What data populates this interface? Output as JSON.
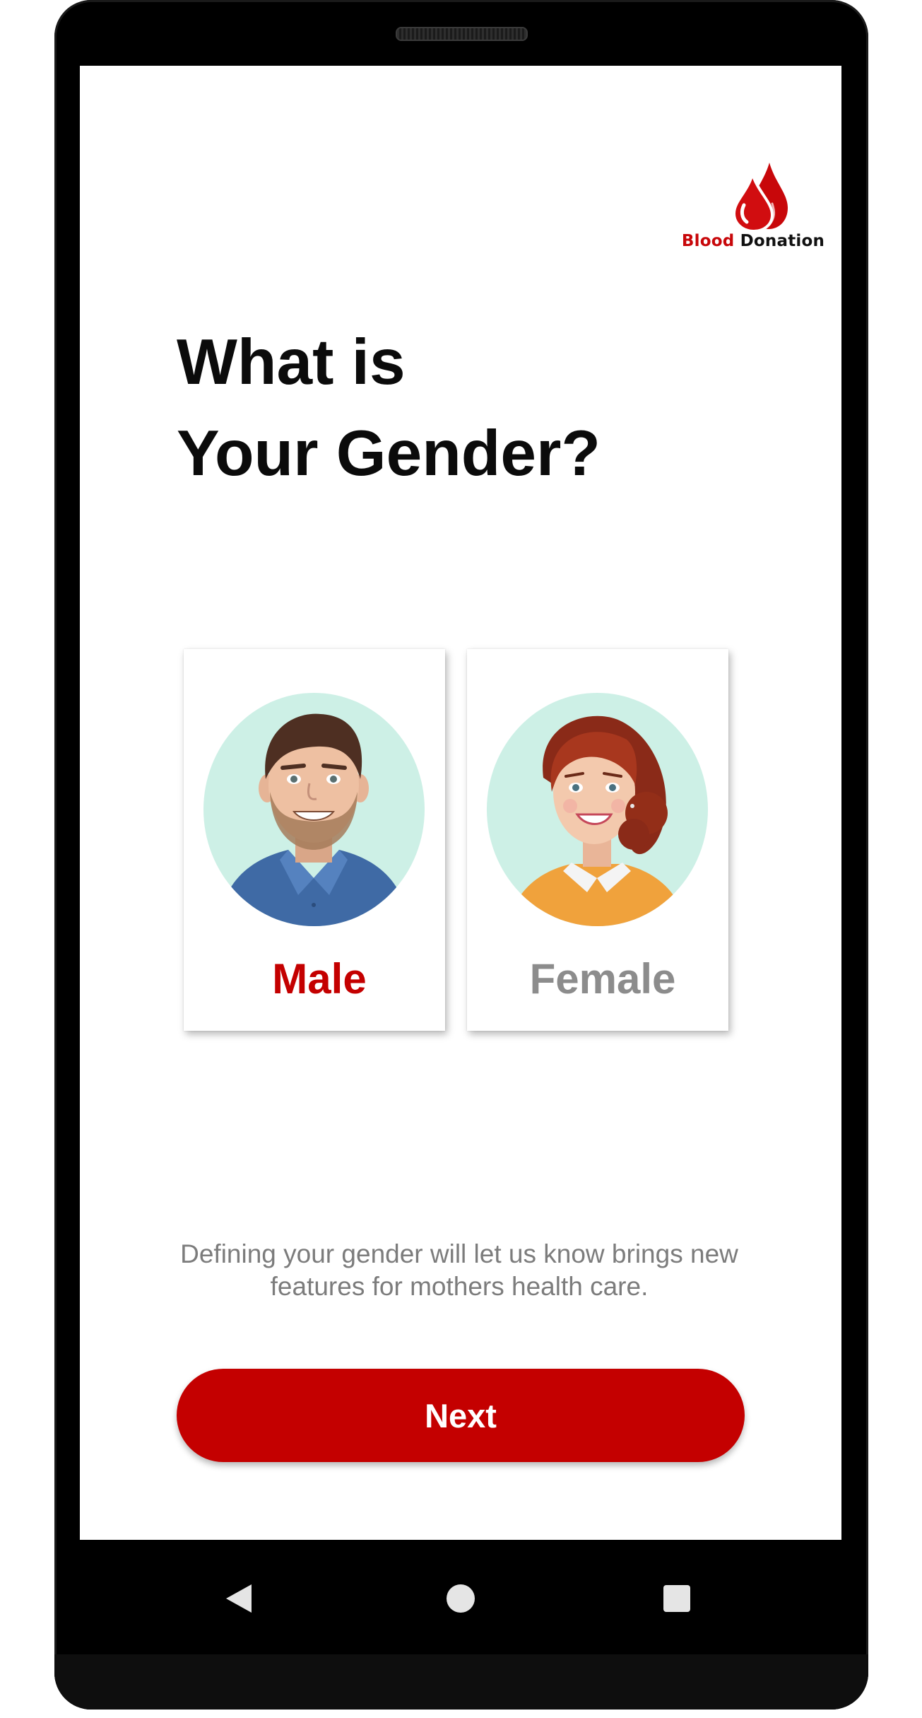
{
  "logo": {
    "word_red": "Blood",
    "word_black": "Donation",
    "brand_color": "#c8070a"
  },
  "title": {
    "line1": "What is",
    "line2": "Your Gender?"
  },
  "options": [
    {
      "label": "Male",
      "selected": true,
      "icon": "male-avatar-icon",
      "color": "#c40000"
    },
    {
      "label": "Female",
      "selected": false,
      "icon": "female-avatar-icon",
      "color": "#8c8c8c"
    }
  ],
  "description": "Defining your gender will let us know brings new features for mothers health care.",
  "next_button": {
    "label": "Next",
    "color": "#c40000"
  },
  "navbar": {
    "back_icon": "back-triangle-icon",
    "home_icon": "home-circle-icon",
    "recents_icon": "recents-square-icon"
  }
}
